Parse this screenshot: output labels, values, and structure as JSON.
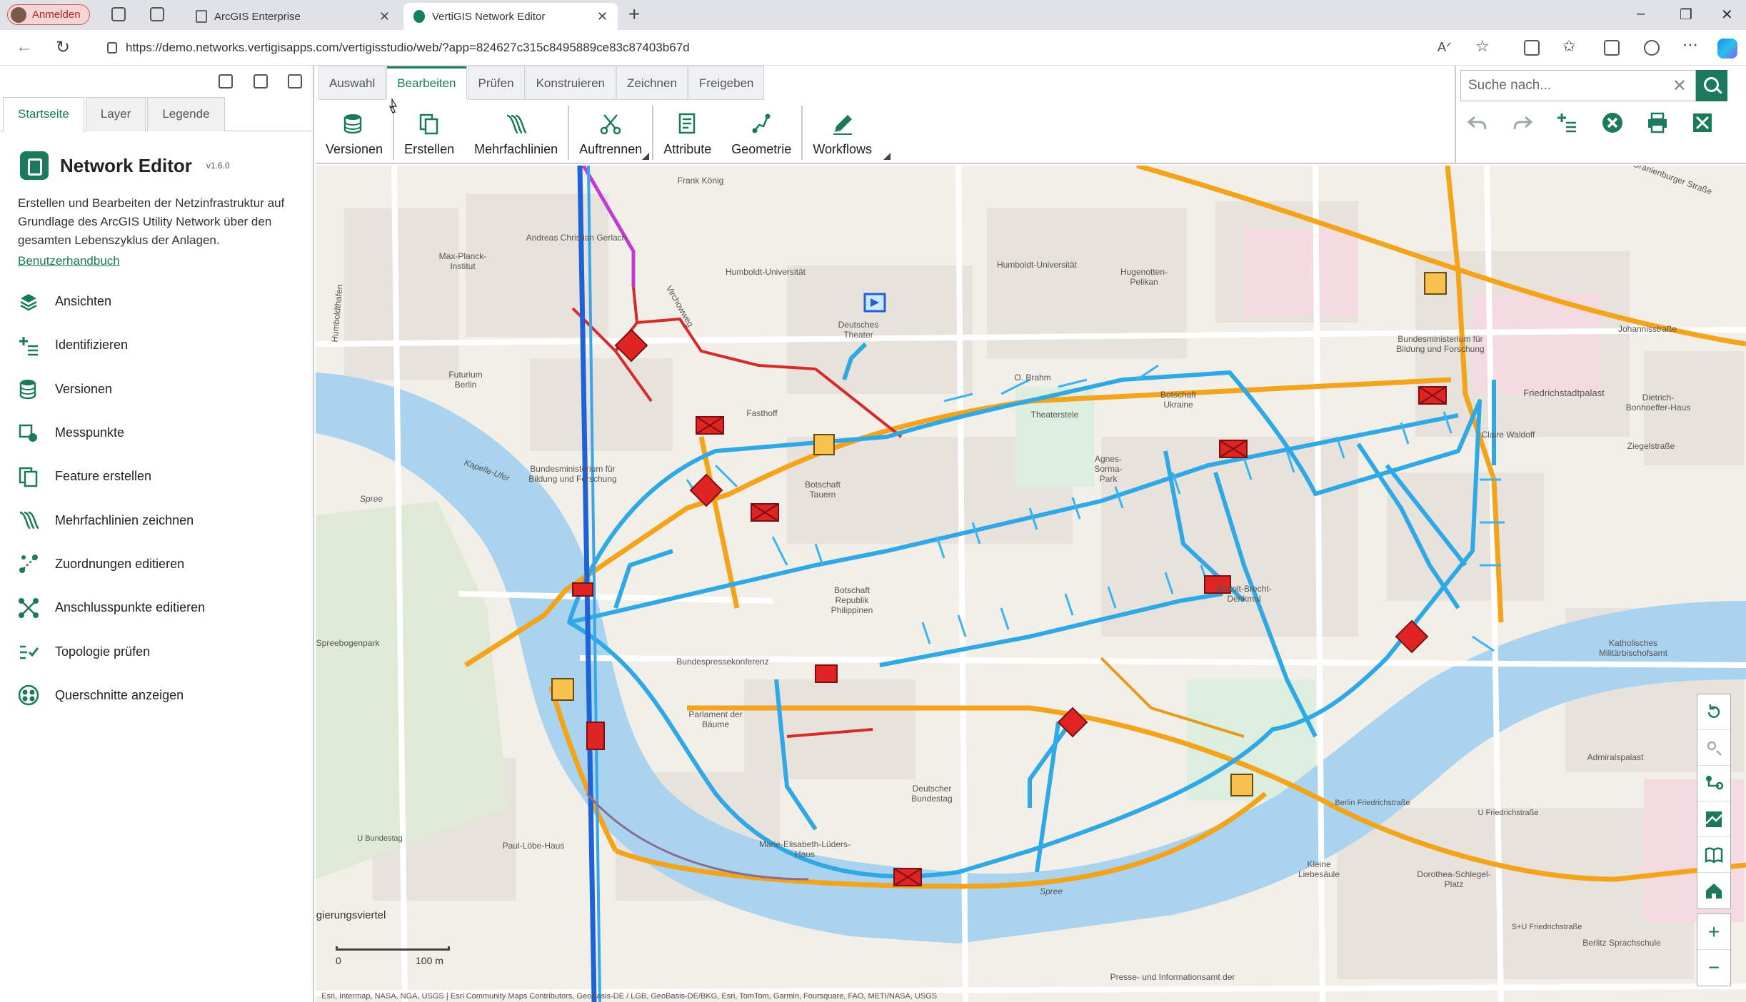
{
  "browser": {
    "profile_label": "Anmelden",
    "tabs": [
      {
        "title": "ArcGIS Enterprise",
        "active": false
      },
      {
        "title": "VertiGIS Network Editor",
        "active": true
      }
    ],
    "url": "https://demo.networks.vertigisapps.com/vertigisstudio/web/?app=824627c315c8495889ce83c87403b67d"
  },
  "left_panel": {
    "tabs": [
      "Startseite",
      "Layer",
      "Legende"
    ],
    "title": "Network Editor",
    "version": "v1.6.0",
    "description": "Erstellen und Bearbeiten der Netzinfrastruktur auf Grundlage des ArcGIS Utility Network über den gesamten Lebenszyklus der Anlagen.",
    "manual_link": "Benutzerhandbuch",
    "menu": [
      {
        "label": "Ansichten",
        "icon": "layers-icon"
      },
      {
        "label": "Identifizieren",
        "icon": "identify-icon"
      },
      {
        "label": "Versionen",
        "icon": "versions-icon"
      },
      {
        "label": "Messpunkte",
        "icon": "measure-points-icon"
      },
      {
        "label": "Feature erstellen",
        "icon": "create-feature-icon"
      },
      {
        "label": "Mehrfachlinien zeichnen",
        "icon": "multiline-icon"
      },
      {
        "label": "Zuordnungen editieren",
        "icon": "associations-icon"
      },
      {
        "label": "Anschlusspunkte editieren",
        "icon": "connection-points-icon"
      },
      {
        "label": "Topologie prüfen",
        "icon": "topology-icon"
      },
      {
        "label": "Querschnitte anzeigen",
        "icon": "cross-section-icon"
      }
    ]
  },
  "ribbon": {
    "tabs": [
      "Auswahl",
      "Bearbeiten",
      "Prüfen",
      "Konstruieren",
      "Zeichnen",
      "Freigeben"
    ],
    "active_tab": "Bearbeiten",
    "tools": [
      "Versionen",
      "Erstellen",
      "Mehrfachlinien",
      "Auftrennen",
      "Attribute",
      "Geometrie",
      "Workflows"
    ]
  },
  "search": {
    "placeholder": "Suche nach..."
  },
  "map": {
    "labels": [
      "Max-Planck-Institut",
      "Andreas Christian Gerlach",
      "Humboldt-Universität",
      "Humboldt-Universität",
      "Hugenotten-Pelikan",
      "Deutsches Theater",
      "Futurium Berlin",
      "Bundesministerium für Bildung und Forschung",
      "Bundesministerium für Bildung und Forschung",
      "Friedrichstadtpalast",
      "Dietrich-Bonhoeffer-Haus",
      "Claire Waldoff",
      "Theaterstele",
      "Agnes-Sorma-Park",
      "Botschaft Tauern",
      "Kapelle-Ufer",
      "Spree",
      "Bundespressekonferenz",
      "Parlament der Bäume",
      "Botschaft Republik Philippinen",
      "Bertolt-Brecht-Denkmal",
      "Katholisches Militärbischofsamt",
      "Admiralspalast",
      "Berlin Friedrichstraße",
      "U Friedrichstraße",
      "Deutscher Bundestag",
      "Paul-Löbe-Haus",
      "Marie-Elisabeth-Lüders-Haus",
      "U Bundestag",
      "Kleine Liebesäule",
      "Dorothea-Schlegel-Platz",
      "S+U Friedrichstraße",
      "Berlitz Sprachschule",
      "Presse- und Informationsamt der",
      "Johannisstraße",
      "Ziegelstraße",
      "Oranienburger Straße",
      "Humboldthafen",
      "Virchowweg",
      "Spree",
      "Frank König",
      "Fasthoff",
      "O. Brahm",
      "Botschaft Ukraine",
      "Spreebogenpark",
      "Regierungsviertel"
    ],
    "scale": {
      "left": "0",
      "right": "100 m"
    },
    "attribution": "Esri, Intermap, NASA, NGA, USGS | Esri Community Maps Contributors, GeoBasis-DE / LGB, GeoBasis-DE/BKG, Esri, TomTom, Garmin, Foursquare, FAO, METI/NASA, USGS",
    "controls": [
      "rotate-icon",
      "locate-icon",
      "trace-icon",
      "basemap-icon",
      "bookmark-icon",
      "home-icon",
      "zoom-in-icon",
      "zoom-out-icon"
    ]
  }
}
